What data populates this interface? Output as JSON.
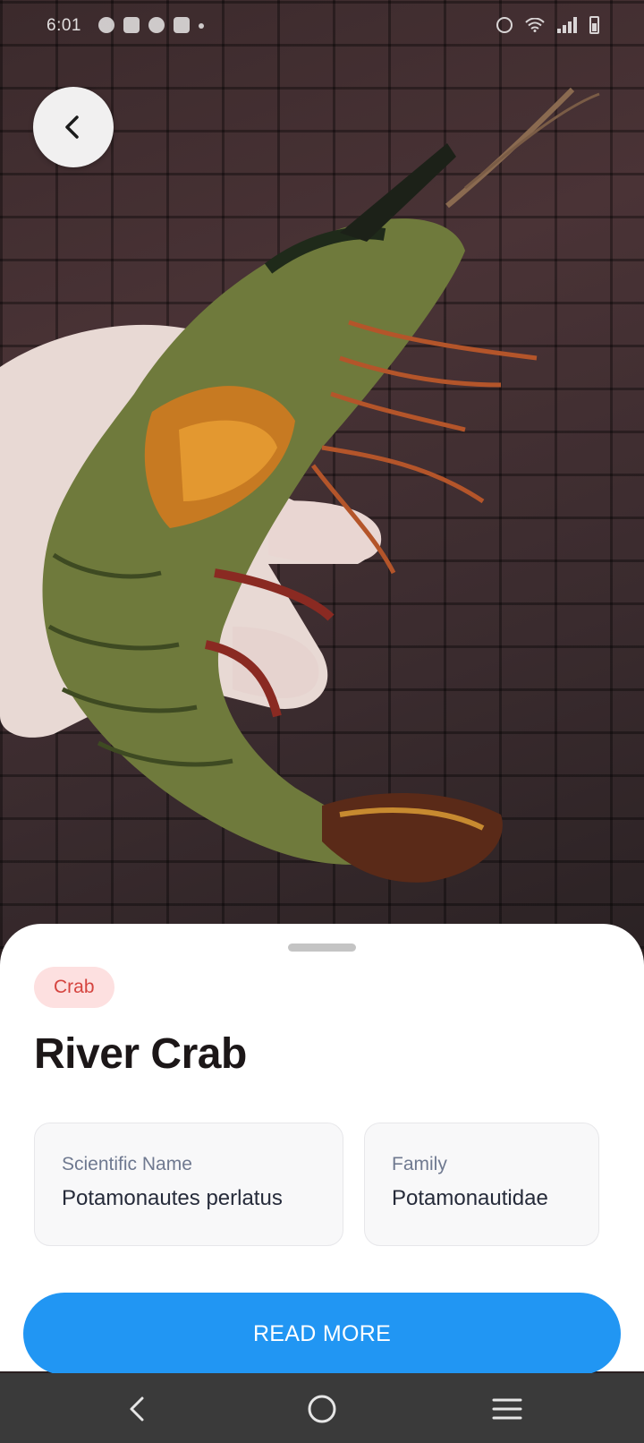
{
  "status_bar": {
    "time": "6:01"
  },
  "header": {
    "back_icon": "chevron-left-icon"
  },
  "animal": {
    "category_tag": "Crab",
    "name": "River Crab",
    "scientific_name_label": "Scientific Name",
    "scientific_name_value": "Potamonautes perlatus",
    "family_label": "Family",
    "family_value": "Potamonautidae"
  },
  "actions": {
    "read_more_label": "READ MORE"
  },
  "nav_bar": {
    "back_icon": "nav-back-icon",
    "home_icon": "nav-home-icon",
    "menu_icon": "nav-recents-icon"
  },
  "colors": {
    "accent": "#2196f3",
    "tag_background": "#fde0e0",
    "tag_text": "#d5443f"
  }
}
